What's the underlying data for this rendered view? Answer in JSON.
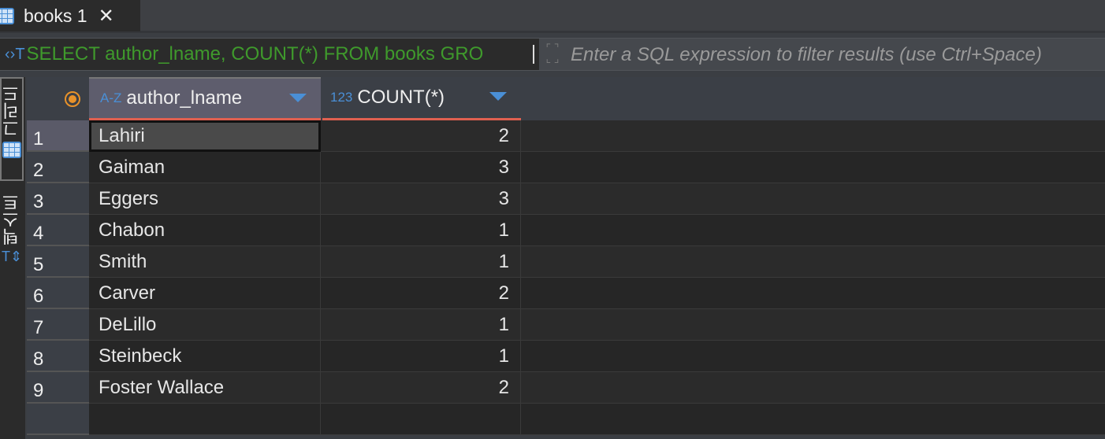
{
  "tab": {
    "title": "books 1",
    "close": "✕"
  },
  "filter": {
    "sql": "SELECT author_lname, COUNT(*) FROM books GRO",
    "placeholder": "Enter a SQL expression to filter results (use Ctrl+Space)"
  },
  "side_tabs": [
    "그리드",
    "텍스트"
  ],
  "columns": [
    {
      "type": "A-Z",
      "name": "author_lname"
    },
    {
      "type": "123",
      "name": "COUNT(*)"
    }
  ],
  "rows": [
    {
      "n": "1",
      "author": "Lahiri",
      "count": "2"
    },
    {
      "n": "2",
      "author": "Gaiman",
      "count": "3"
    },
    {
      "n": "3",
      "author": "Eggers",
      "count": "3"
    },
    {
      "n": "4",
      "author": "Chabon",
      "count": "1"
    },
    {
      "n": "5",
      "author": "Smith",
      "count": "1"
    },
    {
      "n": "6",
      "author": "Carver",
      "count": "2"
    },
    {
      "n": "7",
      "author": "DeLillo",
      "count": "1"
    },
    {
      "n": "8",
      "author": "Steinbeck",
      "count": "1"
    },
    {
      "n": "9",
      "author": "Foster Wallace",
      "count": "2"
    }
  ],
  "colors": {
    "accent": "#4a8fd6",
    "sql": "#3f9a2c",
    "header_underline": "#e06050"
  }
}
